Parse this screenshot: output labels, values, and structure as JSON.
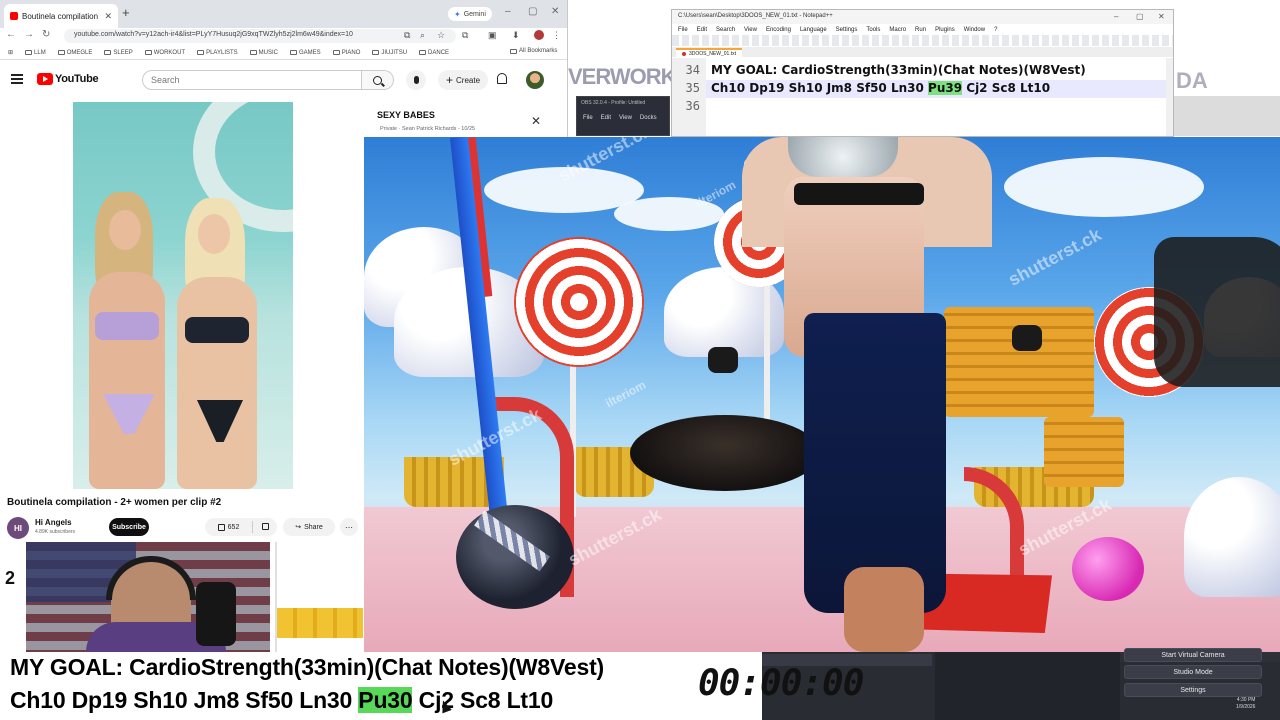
{
  "browser": {
    "tab_title": "Boutinela compilation - 2+ wo",
    "new_tab": "+",
    "gemini_label": "Gemini",
    "url": "youtube.com/watch?v=y12ach-ir4&list=PLyY7Husuq2jG9xqTWZlyh5zj2lm6w49&index=10",
    "bookmarks": [
      "LLM",
      "OMEGLE",
      "SLEEP",
      "WORKOUT",
      "PLAYLISTS",
      "MUSIC",
      "GAMES",
      "PIANO",
      "JIUJITSU",
      "DANCE"
    ],
    "all_bookmarks": "All Bookmarks"
  },
  "youtube": {
    "logo_text": "YouTube",
    "search_placeholder": "Search",
    "create_label": "Create",
    "video_title": "Boutinela compilation - 2+ women per clip #2",
    "channel_initials": "HI",
    "channel_name": "Hi Angels",
    "channel_subs": "4.89K subscribers",
    "subscribe_label": "Subscribe",
    "like_count": "652",
    "share_label": "Share",
    "more_label": "⋯",
    "playlist_title": "SEXY BABES",
    "playlist_sub": "Private · Sean Patrick Richards - 10/25",
    "playlist_close": "✕"
  },
  "notepad": {
    "title": "C:\\Users\\sean\\Desktop\\3DOOS_NEW_01.txt - Notepad++",
    "menu": [
      "File",
      "Edit",
      "Search",
      "View",
      "Encoding",
      "Language",
      "Settings",
      "Tools",
      "Macro",
      "Run",
      "Plugins",
      "Window",
      "?"
    ],
    "tab": "3DOOS_NEW_01.txt",
    "lines": [
      {
        "num": "34",
        "pre": "MY GOAL: CardioStrength(33min)(Chat Notes)(W8Vest)",
        "hl": "",
        "post": ""
      },
      {
        "num": "35",
        "pre": "Ch10 Dp19 Sh10 Jm8 Sf50 Ln30 ",
        "hl": "Pu39",
        "post": " Cj2 Sc8 Lt10"
      },
      {
        "num": "36",
        "pre": "",
        "hl": "",
        "post": ""
      }
    ]
  },
  "obs_small": {
    "title": "OBS 32.0.4 - Profile: Untitled",
    "menu": [
      "File",
      "Edit",
      "View",
      "Docks"
    ]
  },
  "background_text": {
    "left": "VERWORK",
    "right": "DA"
  },
  "side_number": "2",
  "scene": {
    "watermark": "shutterst.ck",
    "watermark2": "ilteriom"
  },
  "overlay": {
    "goal_line": "MY GOAL: CardioStrength(33min)(Chat Notes)(W8Vest)",
    "stats_pre": "Ch10 Dp19 Sh10 Jm8 Sf50 Ln30 ",
    "stats_hl": "Pu30",
    "stats_post": " Cj2 Sc8 Lt10",
    "timer": "00:00:00"
  },
  "obs_dock": {
    "buttons": [
      "Start Virtual Camera",
      "Studio Mode",
      "Settings"
    ],
    "clock_time": "4:30 PM",
    "clock_date": "1/9/2026"
  },
  "colors": {
    "stat_highlight": "#58d858",
    "youtube_red": "#ff0000",
    "obs_dark": "#2a2c34"
  }
}
